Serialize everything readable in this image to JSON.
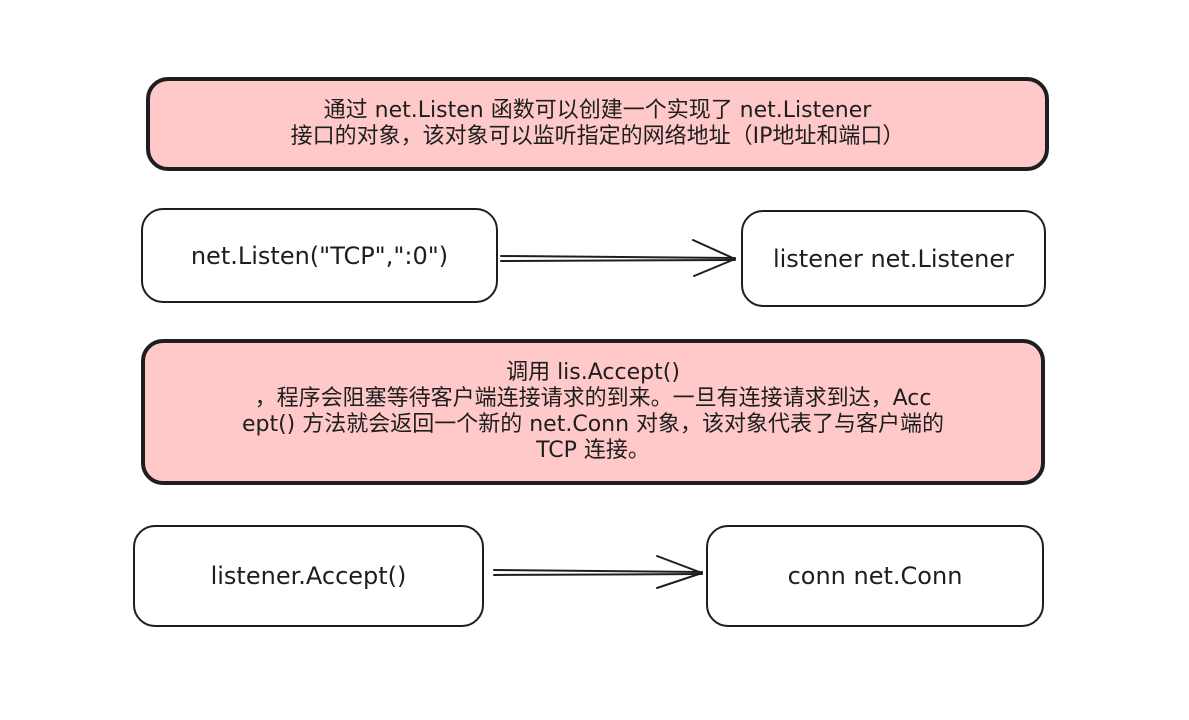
{
  "notes": {
    "listen_note": "通过 net.Listen 函数可以创建一个实现了 net.Listener\n接口的对象，该对象可以监听指定的网络地址（IP地址和端口）",
    "accept_note": "调用 lis.Accept()\n，程序会阻塞等待客户端连接请求的到来。一旦有连接请求到达，Acc\nept() 方法就会返回一个新的 net.Conn 对象，该对象代表了与客户端的\nTCP 连接。"
  },
  "nodes": {
    "listen_call": "net.Listen(\"TCP\",\":0\")",
    "listener_result": "listener net.Listener",
    "accept_call": "listener.Accept()",
    "conn_result": "conn net.Conn"
  },
  "colors": {
    "note_fill": "#ffc9c9",
    "stroke": "#1e1e1e",
    "box_fill": "#ffffff"
  }
}
